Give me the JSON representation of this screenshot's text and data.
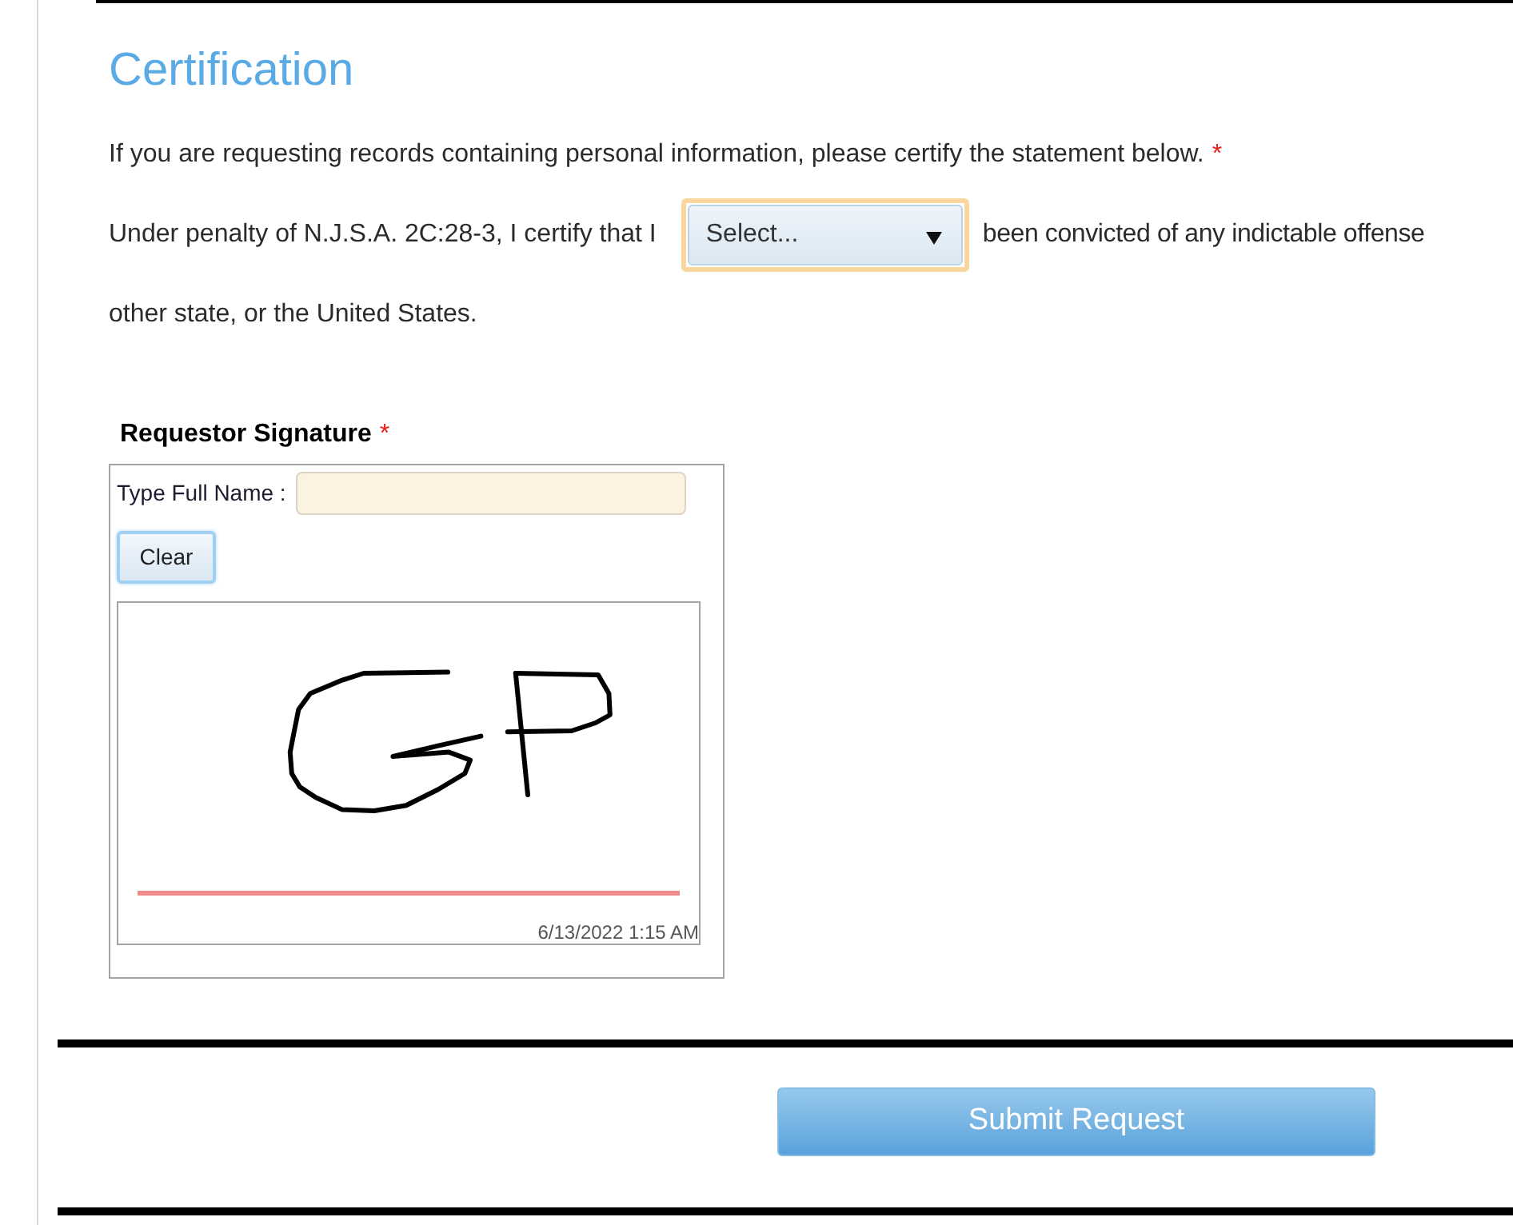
{
  "section": {
    "title": "Certification"
  },
  "instruction": {
    "text": "If you are requesting records containing personal information, please certify the statement below.",
    "required_mark": "*"
  },
  "statement": {
    "text_before": "Under penalty of N.J.S.A. 2C:28-3, I certify that I",
    "select": {
      "value": "Select...",
      "highlighted": true
    },
    "text_after": "been convicted of any indictable offense",
    "continuation": "other state, or the United States."
  },
  "signature": {
    "title": "Requestor Signature",
    "required_mark": "*",
    "name_field": {
      "label": "Type Full Name :"
    },
    "clear_button": "Clear",
    "timestamp": "6/13/2022 1:15 AM"
  },
  "submit_button": "Submit Request"
}
